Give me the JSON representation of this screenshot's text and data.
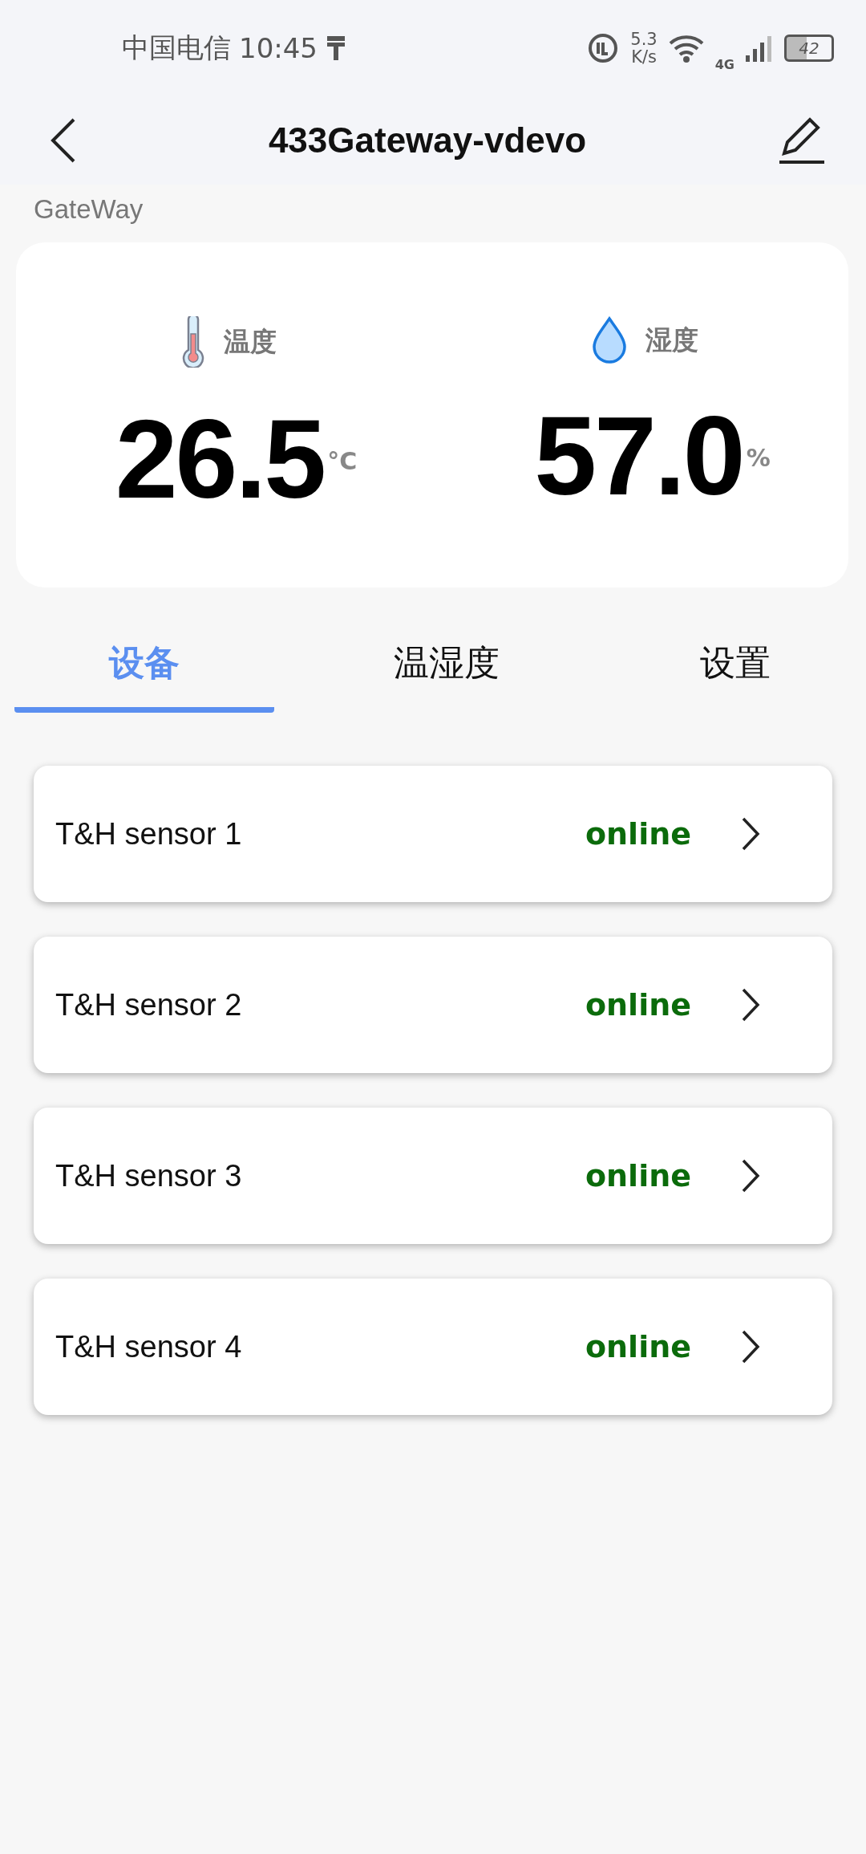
{
  "status_bar": {
    "carrier": "中国电信",
    "time": "10:45",
    "speed_value": "5.3",
    "speed_unit": "K/s",
    "network": "4G",
    "battery": "42"
  },
  "header": {
    "title": "433Gateway-vdevo",
    "subtitle": "GateWay"
  },
  "readings": [
    {
      "kind": "temperature",
      "label": "温度",
      "value": "26.5",
      "unit": "°C"
    },
    {
      "kind": "humidity",
      "label": "湿度",
      "value": "57.0",
      "unit": "%"
    }
  ],
  "tabs": [
    {
      "label": "设备",
      "selected": true
    },
    {
      "label": "温湿度",
      "selected": false
    },
    {
      "label": "设置",
      "selected": false
    }
  ],
  "devices": [
    {
      "name": "T&H sensor 1",
      "status": "online",
      "color": "#0b6b0b"
    },
    {
      "name": "T&H sensor 2",
      "status": "online",
      "color": "#0b6b0b"
    },
    {
      "name": "T&H sensor 3",
      "status": "online",
      "color": "#0b6b0b"
    },
    {
      "name": "T&H sensor 4",
      "status": "online",
      "color": "#0b6b0b"
    }
  ]
}
